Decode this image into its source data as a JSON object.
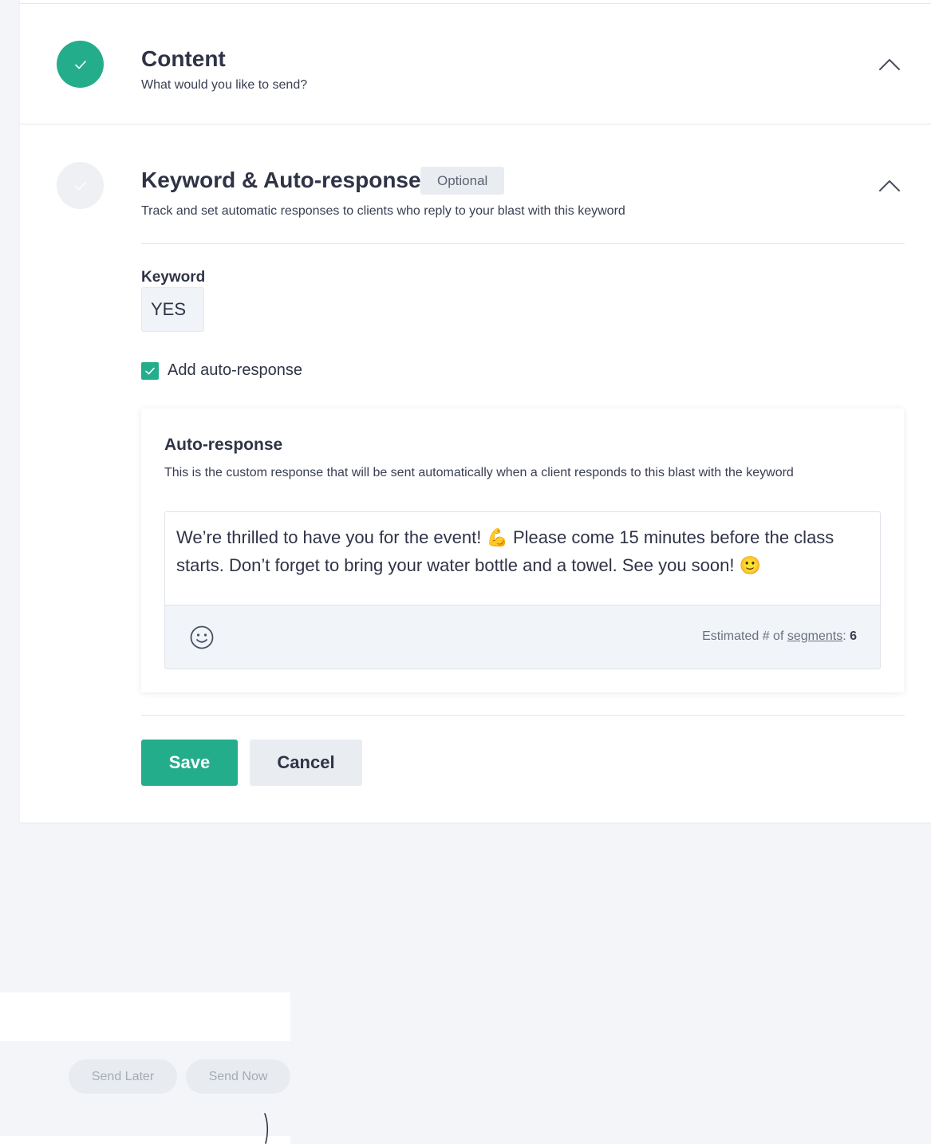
{
  "colors": {
    "accent": "#24ad8b",
    "pending_circle": "#eef0f3",
    "page_background": "#f3f5f9",
    "badge_background": "#e9ecf0"
  },
  "content_step": {
    "title": "Content",
    "subtitle": "What would you like to send?",
    "completed": true,
    "status_icon": "check-icon",
    "toggle_icon": "chevron-up-icon"
  },
  "keyword_step": {
    "title": "Keyword & Auto-response",
    "badge": "Optional",
    "subtitle": "Track and set automatic responses to clients who reply to your blast with this keyword",
    "completed": false,
    "status_icon": "check-icon",
    "toggle_icon": "chevron-up-icon",
    "keyword_label": "Keyword",
    "keyword_value": "YES",
    "auto_response_checkbox_label": "Add auto-response",
    "auto_response_checked": true
  },
  "auto_response": {
    "title": "Auto-response",
    "description": "This is the custom response that will be sent automatically when a client responds to this blast with the keyword",
    "message": "We’re thrilled to have you for the event! 💪 Please come 15 minutes before the class starts. Don’t forget to bring your water bottle and a towel. See you soon! 🙂",
    "emoji_icon": "smiley-icon",
    "segments_prefix": "Estimated # of ",
    "segments_link": "segments",
    "segments_sep": ": ",
    "segments_value": "6"
  },
  "actions": {
    "save_label": "Save",
    "cancel_label": "Cancel"
  },
  "footer_actions": {
    "send_later_label": "Send Later",
    "send_now_label": "Send Now"
  }
}
